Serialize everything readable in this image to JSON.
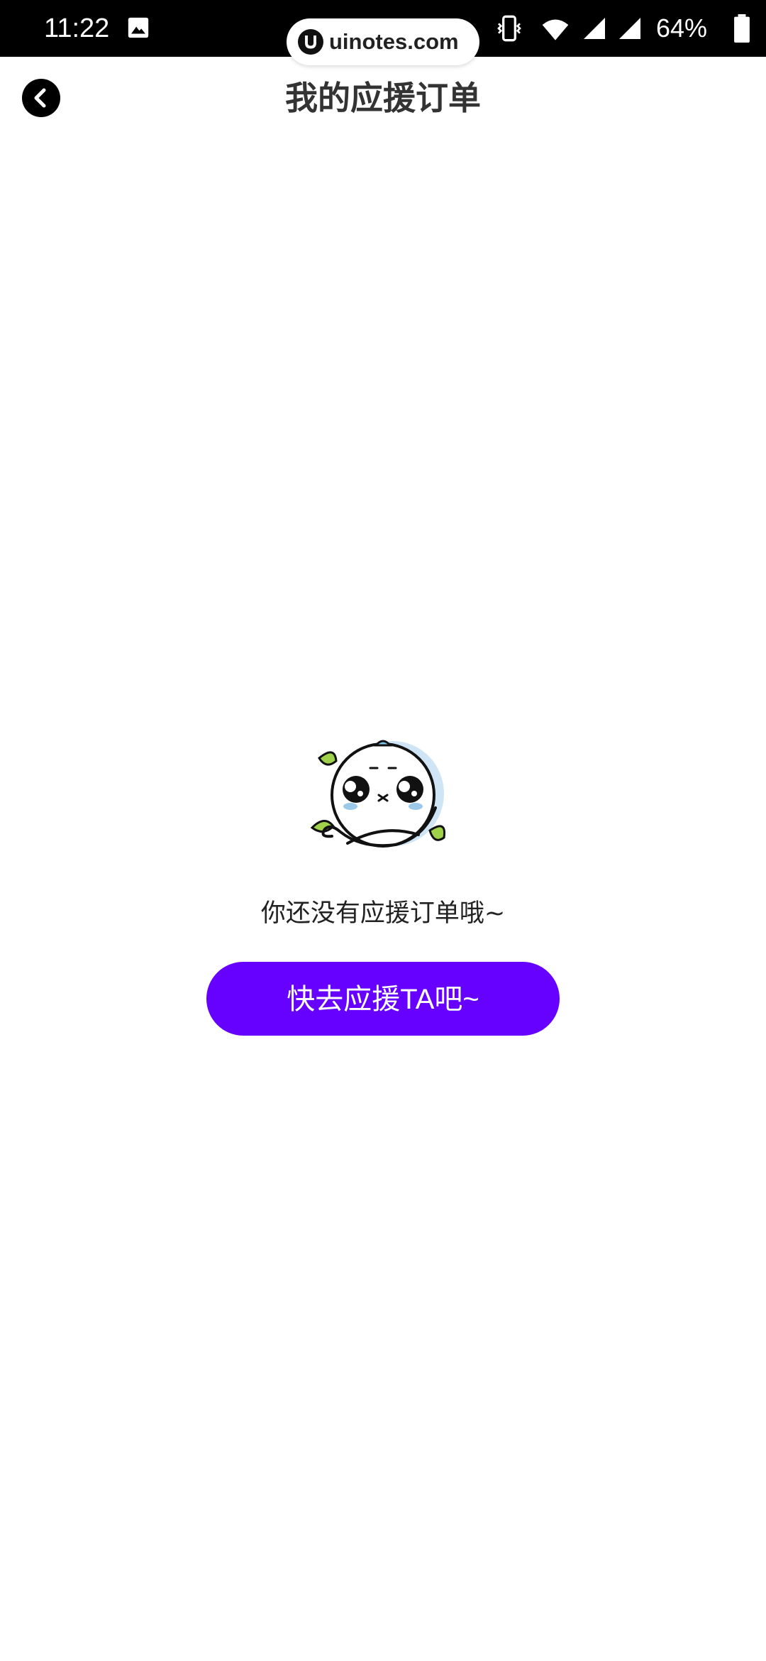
{
  "status_bar": {
    "time": "11:22",
    "battery": "64%",
    "icons": [
      "gallery-icon",
      "vibrate-icon",
      "wifi-icon",
      "signal-icon",
      "signal-icon",
      "battery-icon"
    ]
  },
  "watermark": {
    "text": "uinotes.com"
  },
  "header": {
    "title": "我的应援订单",
    "back_icon": "back-arrow-icon"
  },
  "empty_state": {
    "message": "你还没有应援订单哦~",
    "cta_label": "快去应援TA吧~",
    "illustration": "crying-mascot-illustration"
  },
  "colors": {
    "accent": "#6600ff",
    "status_bar": "#000000",
    "title": "#333333"
  }
}
